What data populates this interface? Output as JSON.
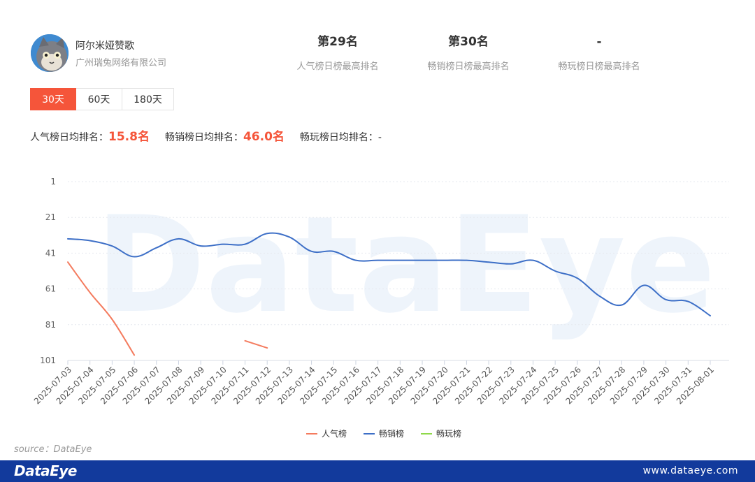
{
  "app": {
    "name": "阿尔米娅赞歌",
    "company": "广州瑞兔网络有限公司"
  },
  "stats": [
    {
      "value": "第29名",
      "label": "人气榜日榜最高排名"
    },
    {
      "value": "第30名",
      "label": "畅销榜日榜最高排名"
    },
    {
      "value": "-",
      "label": "畅玩榜日榜最高排名"
    }
  ],
  "tabs": [
    {
      "label": "30天",
      "active": true
    },
    {
      "label": "60天",
      "active": false
    },
    {
      "label": "180天",
      "active": false
    }
  ],
  "averages": [
    {
      "label": "人气榜日均排名：",
      "value": "15.8名"
    },
    {
      "label": "畅销榜日均排名：",
      "value": "46.0名"
    },
    {
      "label": "畅玩榜日均排名：",
      "value": "-"
    }
  ],
  "watermark": "DataEye",
  "source": "source：DataEye",
  "footer": {
    "brand": "DataEye",
    "url": "www.dataeye.com"
  },
  "chart_data": {
    "type": "line",
    "y_inverted": true,
    "ylim": [
      1,
      101
    ],
    "yticks": [
      1,
      21,
      41,
      61,
      81,
      101
    ],
    "grid": true,
    "legend_position": "bottom-center",
    "categories": [
      "2025-07-03",
      "2025-07-04",
      "2025-07-05",
      "2025-07-06",
      "2025-07-07",
      "2025-07-08",
      "2025-07-09",
      "2025-07-10",
      "2025-07-11",
      "2025-07-12",
      "2025-07-13",
      "2025-07-14",
      "2025-07-15",
      "2025-07-16",
      "2025-07-17",
      "2025-07-18",
      "2025-07-19",
      "2025-07-20",
      "2025-07-21",
      "2025-07-22",
      "2025-07-23",
      "2025-07-24",
      "2025-07-25",
      "2025-07-26",
      "2025-07-27",
      "2025-07-28",
      "2025-07-29",
      "2025-07-30",
      "2025-07-31",
      "2025-08-01"
    ],
    "series": [
      {
        "name": "人气榜",
        "color": "#f47b5e",
        "values": [
          46,
          63,
          78,
          98,
          null,
          null,
          null,
          null,
          90,
          94,
          null,
          null,
          null,
          null,
          null,
          null,
          null,
          null,
          null,
          null,
          null,
          null,
          null,
          null,
          null,
          null,
          null,
          null,
          null,
          null
        ]
      },
      {
        "name": "畅销榜",
        "color": "#3d6fc7",
        "values": [
          33,
          34,
          37,
          43,
          38,
          33,
          37,
          36,
          36,
          30,
          32,
          40,
          40,
          45,
          45,
          45,
          45,
          45,
          45,
          46,
          47,
          45,
          51,
          55,
          65,
          70,
          59,
          67,
          68,
          76
        ]
      },
      {
        "name": "畅玩榜",
        "color": "#8fd94a",
        "values": []
      }
    ]
  }
}
